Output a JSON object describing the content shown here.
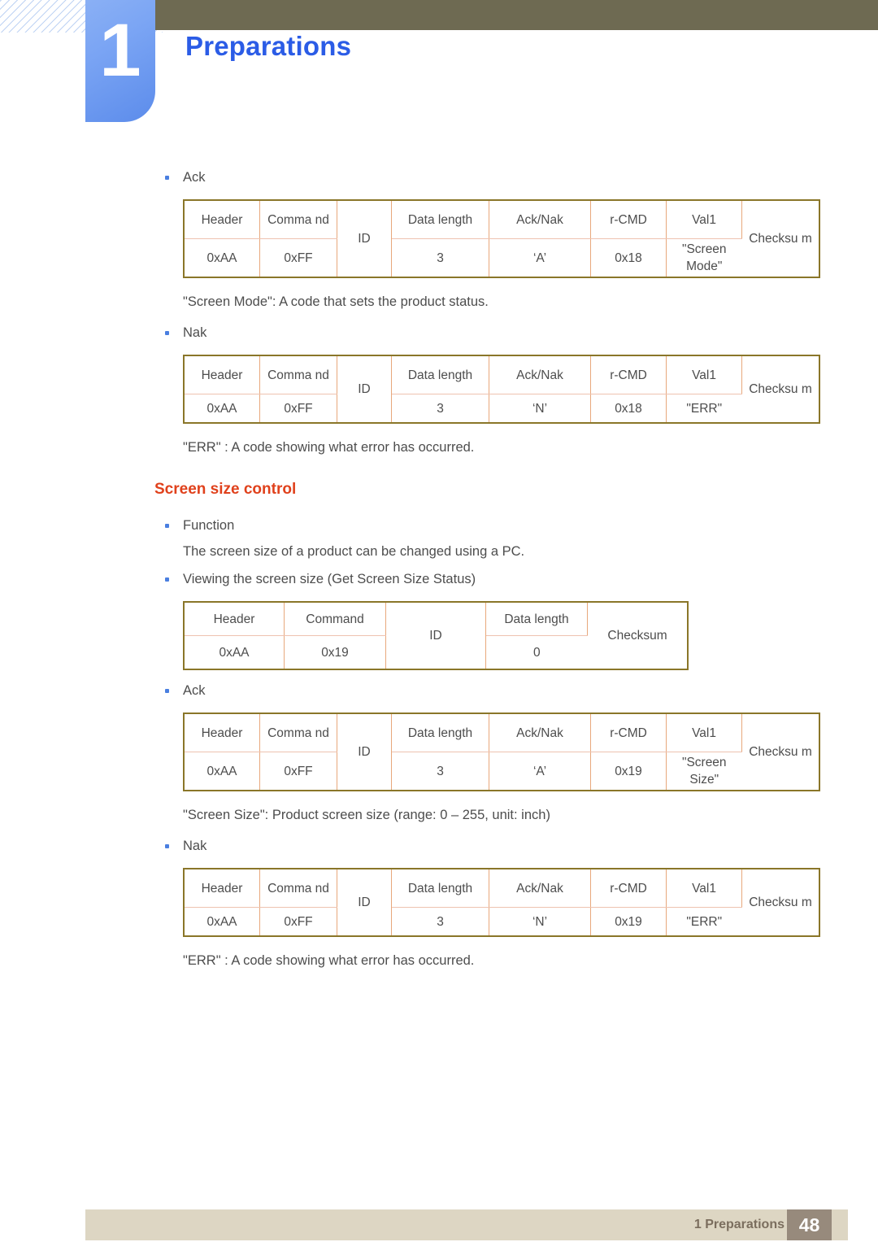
{
  "header": {
    "chapter_number": "1",
    "chapter_title": "Preparations"
  },
  "footer": {
    "label": "1 Preparations",
    "page_number": "48"
  },
  "sections": {
    "screen_mode_ack_bullet": "Ack",
    "screen_mode_note": "\"Screen Mode\": A code that sets the product status.",
    "screen_mode_nak_bullet": "Nak",
    "screen_mode_err_note": "\"ERR\" : A code showing what error has occurred.",
    "screen_size_heading": "Screen size control",
    "function_bullet": "Function",
    "function_text": "The screen size of a product can be changed using a PC.",
    "viewing_bullet": "Viewing the screen size (Get Screen Size Status)",
    "screen_size_ack_bullet": "Ack",
    "screen_size_note": "\"Screen Size\": Product screen size (range: 0 – 255, unit: inch)",
    "screen_size_nak_bullet": "Nak",
    "screen_size_err_note": "\"ERR\" : A code showing what error has occurred."
  },
  "tables": {
    "screen_mode_ack": {
      "headers": [
        "Header",
        "Comma\nnd",
        "ID",
        "Data length",
        "Ack/Nak",
        "r-CMD",
        "Val1",
        "Checksu\nm"
      ],
      "header_cells": {
        "header": "Header",
        "command": "Comma nd",
        "id": "ID",
        "data_length": "Data length",
        "ack_nak": "Ack/Nak",
        "r_cmd": "r-CMD",
        "val1": "Val1",
        "checksum": "Checksu m"
      },
      "values": {
        "header": "0xAA",
        "command": "0xFF",
        "data_length": "3",
        "ack_nak": "‘A’",
        "r_cmd": "0x18",
        "val1": "\"Screen Mode\""
      }
    },
    "screen_mode_nak": {
      "header_cells": {
        "header": "Header",
        "command": "Comma nd",
        "id": "ID",
        "data_length": "Data length",
        "ack_nak": "Ack/Nak",
        "r_cmd": "r-CMD",
        "val1": "Val1",
        "checksum": "Checksu m"
      },
      "values": {
        "header": "0xAA",
        "command": "0xFF",
        "data_length": "3",
        "ack_nak": "‘N’",
        "r_cmd": "0x18",
        "val1": "\"ERR\""
      }
    },
    "get_screen_size": {
      "header_cells": {
        "header": "Header",
        "command": "Command",
        "id": "ID",
        "data_length": "Data length",
        "checksum": "Checksum"
      },
      "values": {
        "header": "0xAA",
        "command": "0x19",
        "data_length": "0"
      }
    },
    "screen_size_ack": {
      "header_cells": {
        "header": "Header",
        "command": "Comma nd",
        "id": "ID",
        "data_length": "Data length",
        "ack_nak": "Ack/Nak",
        "r_cmd": "r-CMD",
        "val1": "Val1",
        "checksum": "Checksu m"
      },
      "values": {
        "header": "0xAA",
        "command": "0xFF",
        "data_length": "3",
        "ack_nak": "‘A’",
        "r_cmd": "0x19",
        "val1": "\"Screen Size\""
      }
    },
    "screen_size_nak": {
      "header_cells": {
        "header": "Header",
        "command": "Comma nd",
        "id": "ID",
        "data_length": "Data length",
        "ack_nak": "Ack/Nak",
        "r_cmd": "r-CMD",
        "val1": "Val1",
        "checksum": "Checksu m"
      },
      "values": {
        "header": "0xAA",
        "command": "0xFF",
        "data_length": "3",
        "ack_nak": "‘N’",
        "r_cmd": "0x19",
        "val1": "\"ERR\""
      }
    }
  },
  "colors": {
    "chapter_tab": "#7ba5f4",
    "chapter_title": "#2b5ce6",
    "olive_bar": "#6e6a52",
    "section_heading": "#e0411c",
    "table_outer_border": "#8a7629",
    "table_inner_border": "#e8a87c",
    "footer_bar": "#ddd6c3",
    "page_box": "#978a7c"
  }
}
